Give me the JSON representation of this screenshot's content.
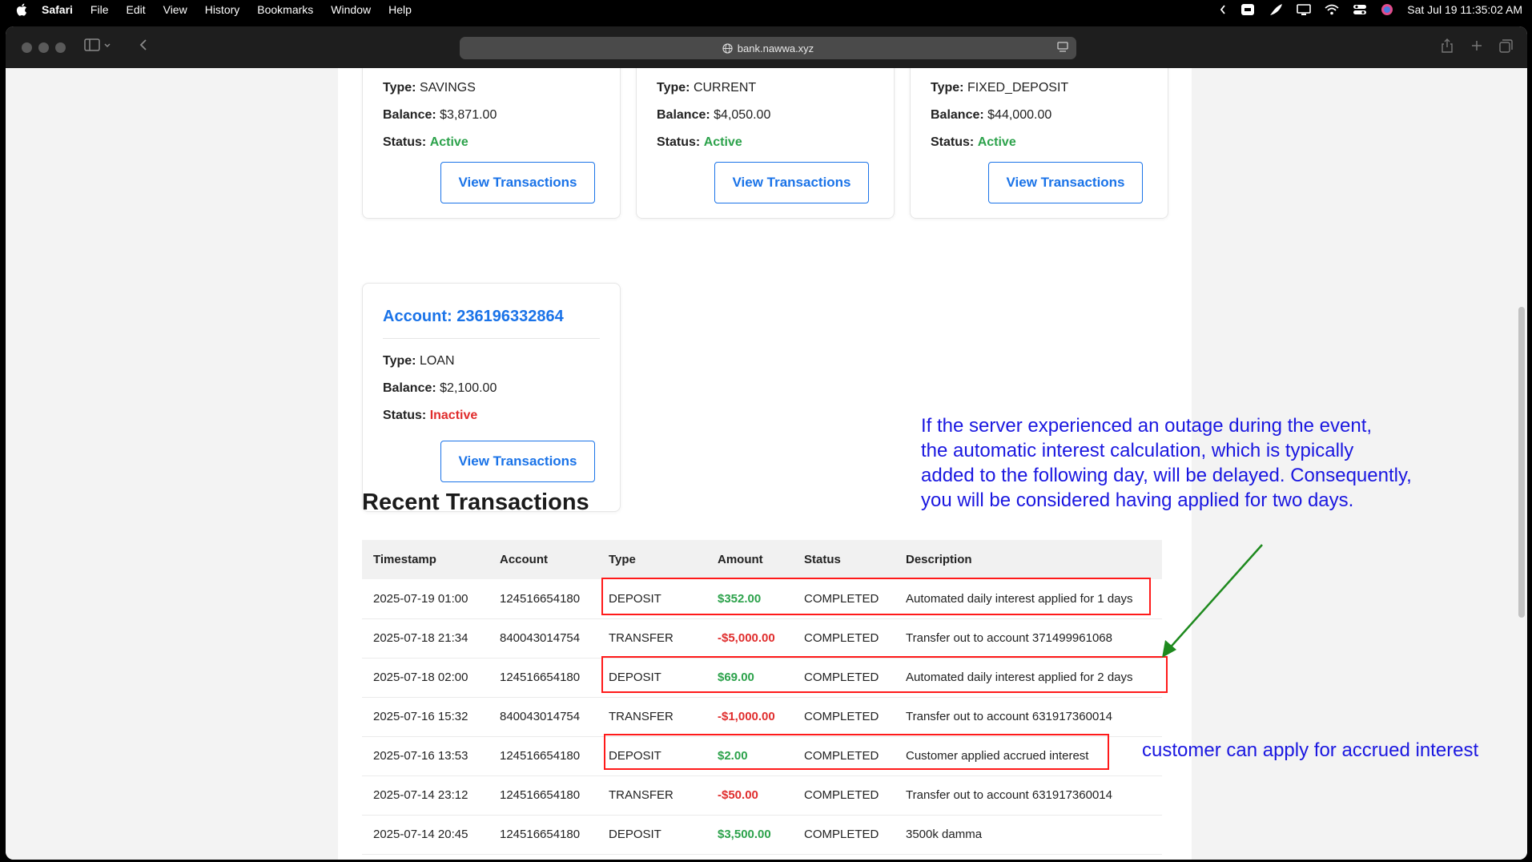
{
  "menubar": {
    "app": "Safari",
    "items": [
      "File",
      "Edit",
      "View",
      "History",
      "Bookmarks",
      "Window",
      "Help"
    ],
    "datetime": "Sat Jul 19  11:35:02 AM"
  },
  "browser": {
    "url": "bank.nawwa.xyz"
  },
  "accounts": [
    {
      "type_label": "Type:",
      "type": "SAVINGS",
      "balance_label": "Balance:",
      "balance": "$3,871.00",
      "status_label": "Status:",
      "status": "Active",
      "button": "View Transactions"
    },
    {
      "type_label": "Type:",
      "type": "CURRENT",
      "balance_label": "Balance:",
      "balance": "$4,050.00",
      "status_label": "Status:",
      "status": "Active",
      "button": "View Transactions"
    },
    {
      "type_label": "Type:",
      "type": "FIXED_DEPOSIT",
      "balance_label": "Balance:",
      "balance": "$44,000.00",
      "status_label": "Status:",
      "status": "Active",
      "button": "View Transactions"
    },
    {
      "title": "Account: 236196332864",
      "type_label": "Type:",
      "type": "LOAN",
      "balance_label": "Balance:",
      "balance": "$2,100.00",
      "status_label": "Status:",
      "status": "Inactive",
      "button": "View Transactions"
    }
  ],
  "recent": {
    "title": "Recent Transactions",
    "headers": [
      "Timestamp",
      "Account",
      "Type",
      "Amount",
      "Status",
      "Description"
    ],
    "rows": [
      {
        "ts": "2025-07-19 01:00",
        "account": "124516654180",
        "type": "DEPOSIT",
        "amount": "$352.00",
        "status": "COMPLETED",
        "desc": "Automated daily interest applied for 1 days"
      },
      {
        "ts": "2025-07-18 21:34",
        "account": "840043014754",
        "type": "TRANSFER",
        "amount": "-$5,000.00",
        "status": "COMPLETED",
        "desc": "Transfer out to account 371499961068"
      },
      {
        "ts": "2025-07-18 02:00",
        "account": "124516654180",
        "type": "DEPOSIT",
        "amount": "$69.00",
        "status": "COMPLETED",
        "desc": "Automated daily interest applied for 2 days"
      },
      {
        "ts": "2025-07-16 15:32",
        "account": "840043014754",
        "type": "TRANSFER",
        "amount": "-$1,000.00",
        "status": "COMPLETED",
        "desc": "Transfer out to account 631917360014"
      },
      {
        "ts": "2025-07-16 13:53",
        "account": "124516654180",
        "type": "DEPOSIT",
        "amount": "$2.00",
        "status": "COMPLETED",
        "desc": "Customer applied accrued interest"
      },
      {
        "ts": "2025-07-14 23:12",
        "account": "124516654180",
        "type": "TRANSFER",
        "amount": "-$50.00",
        "status": "COMPLETED",
        "desc": "Transfer out to account 631917360014"
      },
      {
        "ts": "2025-07-14 20:45",
        "account": "124516654180",
        "type": "DEPOSIT",
        "amount": "$3,500.00",
        "status": "COMPLETED",
        "desc": "3500k damma"
      }
    ]
  },
  "annotations": {
    "note1_lines": [
      "If the server experienced an outage during the event,",
      "the automatic interest calculation, which is typically",
      "added to the following day, will be delayed. Consequently,",
      "you will be considered having applied for two days."
    ],
    "note2": "customer can apply for accrued interest",
    "colors": {
      "box": "#ff1a1a",
      "arrow": "#1e8a1e",
      "text": "#1a17e0"
    }
  }
}
